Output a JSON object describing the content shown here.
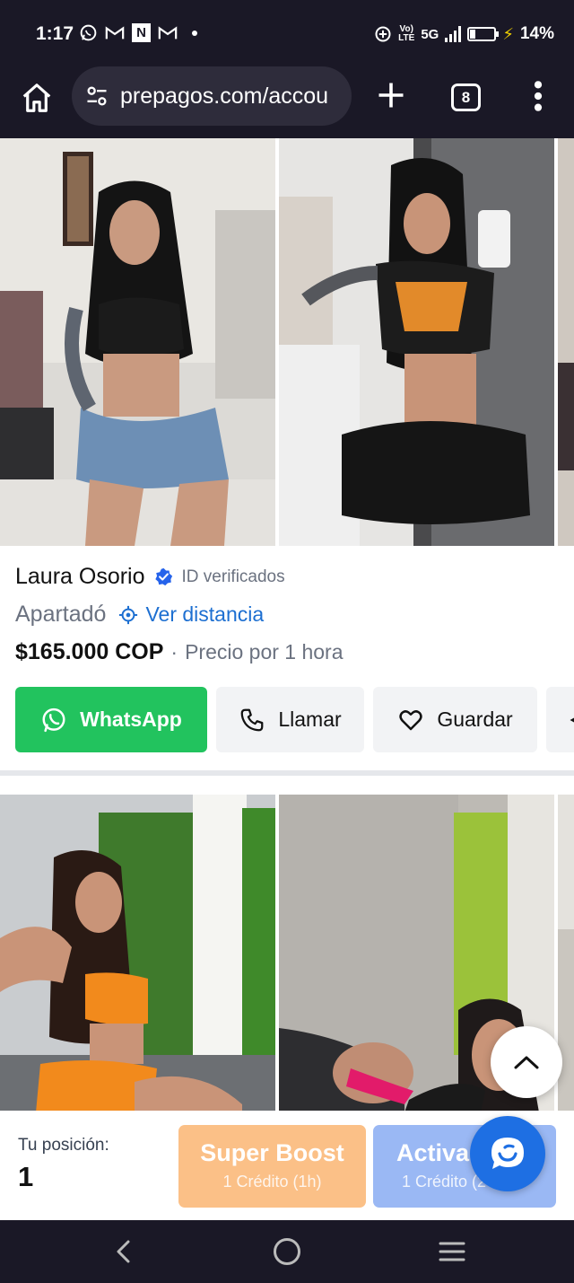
{
  "status_bar": {
    "time": "1:17",
    "left_icons": [
      "whatsapp-notification-icon",
      "gmail-notification-icon",
      "news-notification-icon",
      "gmail-notification-icon",
      "more-notifications-dot"
    ],
    "n_badge": "N",
    "network_volte": "Vo)\nLTE",
    "network_type": "5G",
    "battery_percent": "14%",
    "battery_level": 0.14,
    "charging": true
  },
  "browser": {
    "url": "prepagos.com/accou",
    "tab_count": "8",
    "home_icon": "home-icon",
    "site_settings_icon": "tune-icon",
    "new_tab_icon": "plus-icon",
    "menu_icon": "more-vert-icon"
  },
  "listing": {
    "name": "Laura Osorio",
    "verified_label": "ID verificados",
    "location": "Apartadó",
    "distance_label": "Ver distancia",
    "price": "$165.000 COP",
    "price_separator": "·",
    "price_note": "Precio por 1 hora",
    "buttons": {
      "whatsapp": "WhatsApp",
      "call": "Llamar",
      "save": "Guardar"
    },
    "photos": [
      "listing-photo-1",
      "listing-photo-2",
      "listing-photo-3"
    ]
  },
  "next_listing": {
    "photos": [
      "listing-photo-1",
      "listing-photo-2",
      "listing-photo-3"
    ]
  },
  "promo": {
    "position_label": "Tu posición:",
    "position_value": "1",
    "boost_title": "Super Boost",
    "boost_sub": "1 Crédito (1h)",
    "activa_title": "Activa",
    "activa_sub": "1 Crédito (24h)"
  },
  "colors": {
    "system_bar": "#1a1826",
    "whatsapp_green": "#22c35e",
    "link_blue": "#1d6fd1",
    "verified_blue": "#2563eb",
    "boost_orange": "#fbc087",
    "activa_blue": "#9ab8f4",
    "chat_fab": "#1e6fe3"
  }
}
